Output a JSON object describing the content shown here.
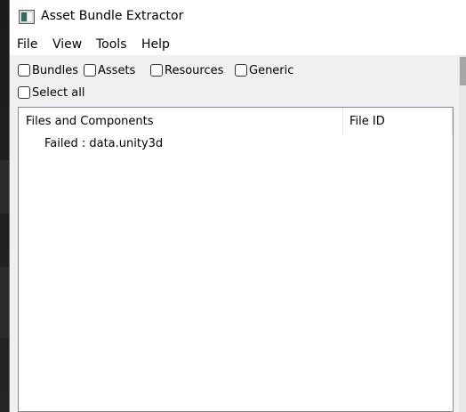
{
  "window": {
    "title": "Asset Bundle Extractor",
    "icon": "app-window-icon"
  },
  "menu": [
    "File",
    "View",
    "Tools",
    "Help"
  ],
  "filters": {
    "bundles": {
      "label": "Bundles",
      "checked": false
    },
    "assets": {
      "label": "Assets",
      "checked": false
    },
    "resources": {
      "label": "Resources",
      "checked": false
    },
    "generic": {
      "label": "Generic",
      "checked": false
    },
    "select_all": {
      "label": "Select all",
      "checked": false
    }
  },
  "tree": {
    "columns": [
      "Files and Components",
      "File ID"
    ],
    "rows": [
      {
        "label": "Failed : data.unity3d",
        "file_id": ""
      }
    ]
  },
  "colors": {
    "window_bg": "#f0f0f0",
    "titlebar_bg": "#ffffff",
    "border": "#828790",
    "desktop": "#1c1c1c"
  }
}
